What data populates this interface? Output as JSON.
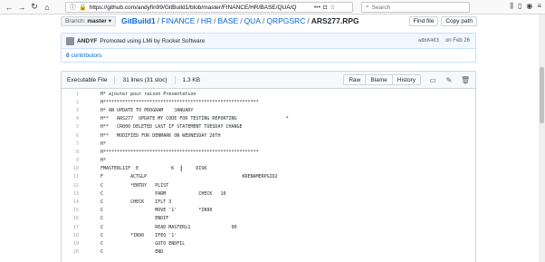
{
  "browser": {
    "url": "https://github.com/andyfin99/GitBuild1/blob/master/FINANCE/HR/BASE/QUA/Q",
    "search_placeholder": "Search"
  },
  "branch": {
    "prefix": "Branch:",
    "name": "master",
    "caret": "▾"
  },
  "breadcrumb": {
    "repo": "GitBuild1",
    "parts": [
      "FINANCE",
      "HR",
      "BASE",
      "QUA",
      "QRPGSRC"
    ],
    "file": "ARS277.RPG",
    "separator": "/"
  },
  "actions": {
    "find_file": "Find file",
    "copy_path": "Copy path"
  },
  "commit": {
    "author": "ANDYF",
    "message": "Promoted using LMi by Rocket Software",
    "sha": "a8b6463",
    "date": "on Feb 26",
    "contributors_count": "0",
    "contributors_label": "contributors"
  },
  "file": {
    "type": "Executable File",
    "lines": "31 lines (31 sloc)",
    "size": "1.3 KB",
    "buttons": {
      "raw": "Raw",
      "blame": "Blame",
      "history": "History"
    }
  },
  "code_lines": [
    {
      "n": "1",
      "t": "H* ajouter pour raison Presentation"
    },
    {
      "n": "2",
      "t": "H*********************************************************"
    },
    {
      "n": "3",
      "t": "H* AN UPDATE TO PROGRAM    JANUARY"
    },
    {
      "n": "4",
      "t": "H**   ARS277  UPDATE MY CODE FOR TESTING REPORTING                  *"
    },
    {
      "n": "5",
      "t": "H**   CR000 DELETED LAST IF STATEMENT TUESDAY CHANGE"
    },
    {
      "n": "6",
      "t": "H**   MODIFIED FOR DENMARK ON WEDNESDAY 26TH"
    },
    {
      "n": "7",
      "t": "H*"
    },
    {
      "n": "8",
      "t": "H*********************************************************"
    },
    {
      "n": "9",
      "t": "H*"
    },
    {
      "n": "10",
      "t": "FMASTERL1IF  E            K        DISK"
    },
    {
      "n": "11",
      "t": "F          ACTGLP                                   KRENAMERPGID2"
    },
    {
      "n": "12",
      "t": "C          *ENTRY   PLIST"
    },
    {
      "n": "13",
      "t": "C                   PARM            CHECK   10"
    },
    {
      "n": "14",
      "t": "C          CHECK    IFLT 3"
    },
    {
      "n": "15",
      "t": "C                   MOVE '1'        *IN90"
    },
    {
      "n": "16",
      "t": "C                   ENDIF"
    },
    {
      "n": "17",
      "t": "C                   READ MASTERL1               90"
    },
    {
      "n": "18",
      "t": "C          *IN90    IFEQ '1'"
    },
    {
      "n": "19",
      "t": "C                   GOTO ENDFIL"
    },
    {
      "n": "20",
      "t": "C                   END"
    }
  ]
}
